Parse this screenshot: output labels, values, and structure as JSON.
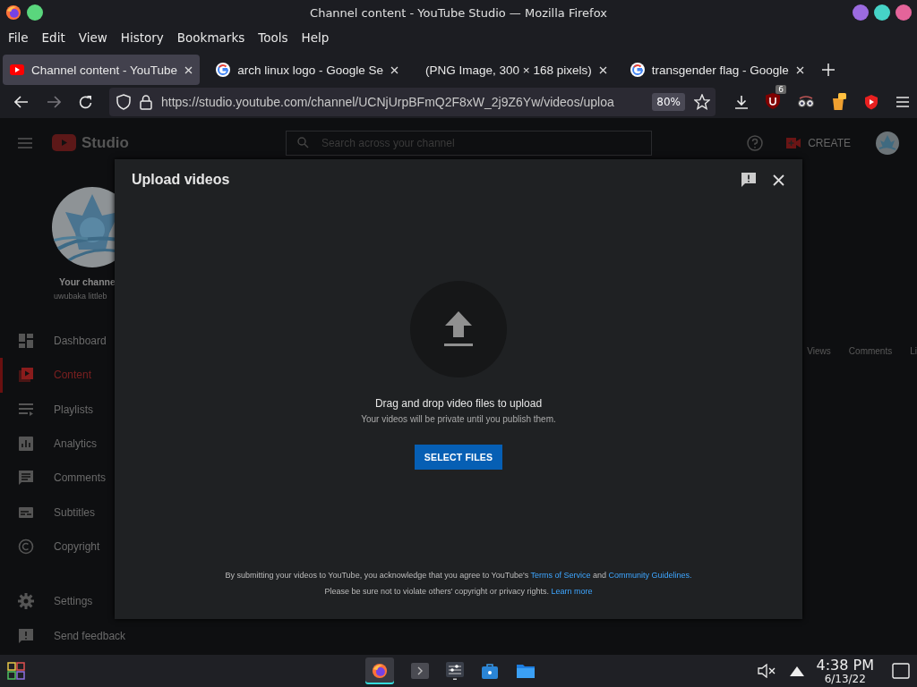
{
  "window": {
    "title": "Channel content - YouTube Studio — Mozilla Firefox"
  },
  "menu": [
    "File",
    "Edit",
    "View",
    "History",
    "Bookmarks",
    "Tools",
    "Help"
  ],
  "tabs": [
    {
      "label": "Channel content - YouTube",
      "kind": "youtube",
      "selected": true
    },
    {
      "label": "arch linux logo - Google Se",
      "kind": "google",
      "selected": false
    },
    {
      "label": "(PNG Image, 300 × 168 pixels)",
      "kind": "plain",
      "selected": false
    },
    {
      "label": "transgender flag - Google",
      "kind": "google",
      "selected": false
    }
  ],
  "navbar": {
    "url": "https://studio.youtube.com/channel/UCNjUrpBFmQ2F8xW_2j9Z6Yw/videos/uploa",
    "zoom": "80%",
    "extension_badge": "6"
  },
  "studio": {
    "logo_text": "Studio",
    "search": {
      "placeholder": "Search across your channel"
    },
    "create": "CREATE",
    "channel": {
      "title": "Your channe",
      "name": "uwubaka littleb"
    },
    "sidebar": {
      "items": [
        {
          "label": "Dashboard",
          "kind": "dashboard",
          "selected": false
        },
        {
          "label": "Content",
          "kind": "content",
          "selected": true
        },
        {
          "label": "Playlists",
          "kind": "playlists",
          "selected": false
        },
        {
          "label": "Analytics",
          "kind": "analytics",
          "selected": false
        },
        {
          "label": "Comments",
          "kind": "comments",
          "selected": false
        },
        {
          "label": "Subtitles",
          "kind": "subtitles",
          "selected": false
        },
        {
          "label": "Copyright",
          "kind": "copyright",
          "selected": false
        },
        {
          "label": "Settings",
          "kind": "settings",
          "selected": false
        },
        {
          "label": "Send feedback",
          "kind": "feedback",
          "selected": false
        }
      ]
    },
    "columns": [
      "Views",
      "Comments",
      "Li"
    ]
  },
  "dialog": {
    "title": "Upload videos",
    "heading": "Drag and drop video files to upload",
    "note": "Your videos will be private until you publish them.",
    "button": "SELECT FILES",
    "legal": [
      [
        {
          "kind": "text",
          "text": "By submitting your videos to YouTube, you acknowledge that you agree to YouTube's"
        },
        {
          "kind": "link",
          "text": "Terms of Service"
        },
        {
          "kind": "text",
          "text": "and"
        },
        {
          "kind": "link",
          "text": "Community Guidelines."
        }
      ],
      [
        {
          "kind": "text",
          "text": "Please be sure not to violate others' copyright or privacy rights."
        },
        {
          "kind": "link",
          "text": "Learn more"
        }
      ]
    ]
  },
  "taskbar": {
    "time": "4:38 PM",
    "date": "6/13/22"
  }
}
